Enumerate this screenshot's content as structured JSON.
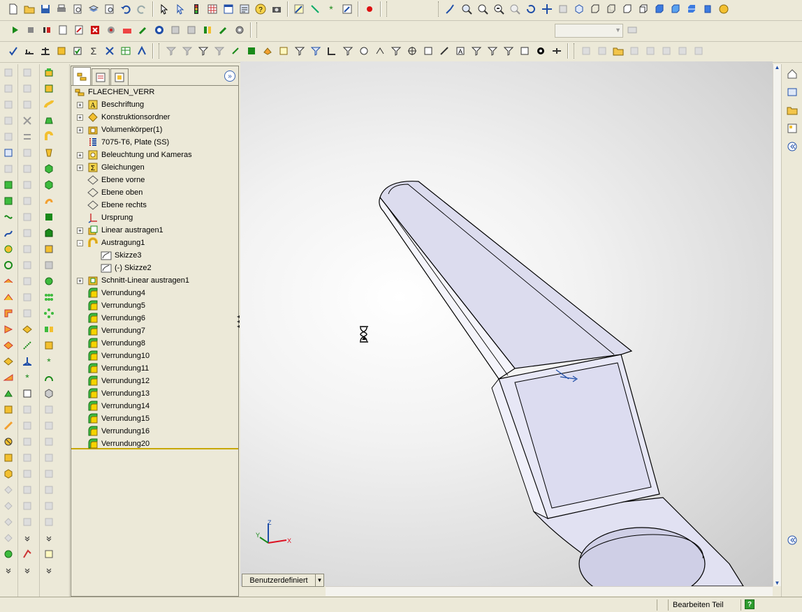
{
  "feature_manager": {
    "root": "FLAECHEN_VERR",
    "items": [
      {
        "label": "Beschriftung",
        "icon": "annotation-icon",
        "expand": "+",
        "indent": 0
      },
      {
        "label": "Konstruktionsordner",
        "icon": "design-folder-icon",
        "expand": "+",
        "indent": 0
      },
      {
        "label": "Volumenkörper(1)",
        "icon": "solid-bodies-icon",
        "expand": "+",
        "indent": 0
      },
      {
        "label": "7075-T6, Plate (SS)",
        "icon": "material-icon",
        "expand": "",
        "indent": 0
      },
      {
        "label": "Beleuchtung und Kameras",
        "icon": "lights-icon",
        "expand": "+",
        "indent": 0
      },
      {
        "label": "Gleichungen",
        "icon": "equations-icon",
        "expand": "+",
        "indent": 0
      },
      {
        "label": "Ebene vorne",
        "icon": "plane-icon",
        "expand": "",
        "indent": 0
      },
      {
        "label": "Ebene oben",
        "icon": "plane-icon",
        "expand": "",
        "indent": 0
      },
      {
        "label": "Ebene rechts",
        "icon": "plane-icon",
        "expand": "",
        "indent": 0
      },
      {
        "label": "Ursprung",
        "icon": "origin-icon",
        "expand": "",
        "indent": 0
      },
      {
        "label": "Linear austragen1",
        "icon": "extrude-icon",
        "expand": "+",
        "indent": 0
      },
      {
        "label": "Austragung1",
        "icon": "sweep-icon",
        "expand": "-",
        "indent": 0
      },
      {
        "label": "Skizze3",
        "icon": "sketch-icon",
        "expand": "",
        "indent": 1
      },
      {
        "label": "(-) Skizze2",
        "icon": "sketch-icon",
        "expand": "",
        "indent": 1
      },
      {
        "label": "Schnitt-Linear austragen1",
        "icon": "cut-extrude-icon",
        "expand": "+",
        "indent": 0
      },
      {
        "label": "Verrundung4",
        "icon": "fillet-icon",
        "expand": "",
        "indent": 0
      },
      {
        "label": "Verrundung5",
        "icon": "fillet-icon",
        "expand": "",
        "indent": 0
      },
      {
        "label": "Verrundung6",
        "icon": "fillet-icon",
        "expand": "",
        "indent": 0
      },
      {
        "label": "Verrundung7",
        "icon": "fillet-icon",
        "expand": "",
        "indent": 0
      },
      {
        "label": "Verrundung8",
        "icon": "fillet-icon",
        "expand": "",
        "indent": 0
      },
      {
        "label": "Verrundung10",
        "icon": "fillet-icon",
        "expand": "",
        "indent": 0
      },
      {
        "label": "Verrundung11",
        "icon": "fillet-icon",
        "expand": "",
        "indent": 0
      },
      {
        "label": "Verrundung12",
        "icon": "fillet-icon",
        "expand": "",
        "indent": 0
      },
      {
        "label": "Verrundung13",
        "icon": "fillet-icon",
        "expand": "",
        "indent": 0
      },
      {
        "label": "Verrundung14",
        "icon": "fillet-icon",
        "expand": "",
        "indent": 0
      },
      {
        "label": "Verrundung15",
        "icon": "fillet-icon",
        "expand": "",
        "indent": 0
      },
      {
        "label": "Verrundung16",
        "icon": "fillet-icon",
        "expand": "",
        "indent": 0
      },
      {
        "label": "Verrundung20",
        "icon": "fillet-icon",
        "expand": "",
        "indent": 0
      }
    ]
  },
  "viewport": {
    "configuration": "Benutzerdefiniert",
    "triad": {
      "x": "X",
      "y": "Y",
      "z": "Z"
    },
    "cursor": "hourglass-icon"
  },
  "status_bar": {
    "mode": "Bearbeiten Teil"
  },
  "colors": {
    "part_face": "#e4e4f4",
    "part_face_top": "#ececf8",
    "part_edge": "#000000",
    "fillet_green": "#3dbb3d",
    "fillet_yellow": "#f5d400",
    "accent_blue": "#1f4ea8"
  }
}
